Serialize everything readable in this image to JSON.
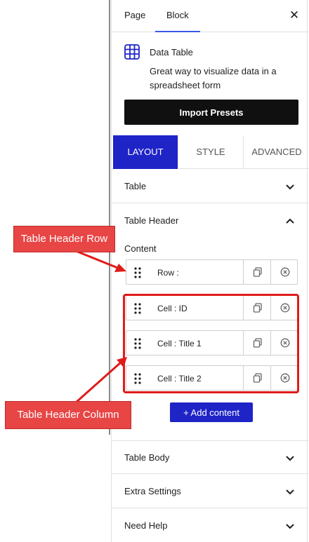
{
  "tabs": {
    "page": "Page",
    "block": "Block",
    "close": "✕"
  },
  "block": {
    "title": "Data Table",
    "description": "Great way to visualize data in a spreadsheet form",
    "import_label": "Import Presets",
    "icon": "table-icon"
  },
  "modes": {
    "layout": "LAYOUT",
    "style": "STYLE",
    "advanced": "ADVANCED"
  },
  "sections": {
    "table": "Table",
    "table_header": "Table Header",
    "table_body": "Table Body",
    "extra_settings": "Extra Settings",
    "need_help": "Need Help"
  },
  "content_label": "Content",
  "items": [
    {
      "label": "Row :"
    },
    {
      "label": "Cell : ID"
    },
    {
      "label": "Cell : Title 1"
    },
    {
      "label": "Cell : Title 2"
    }
  ],
  "add_content": "+ Add content",
  "annotations": {
    "header_row": "Table Header Row",
    "header_column": "Table Header Column"
  },
  "colors": {
    "accent": "#1f24c7",
    "annotation": "#e84545",
    "highlight": "#e01b1b",
    "tab_active": "#3858e9"
  }
}
